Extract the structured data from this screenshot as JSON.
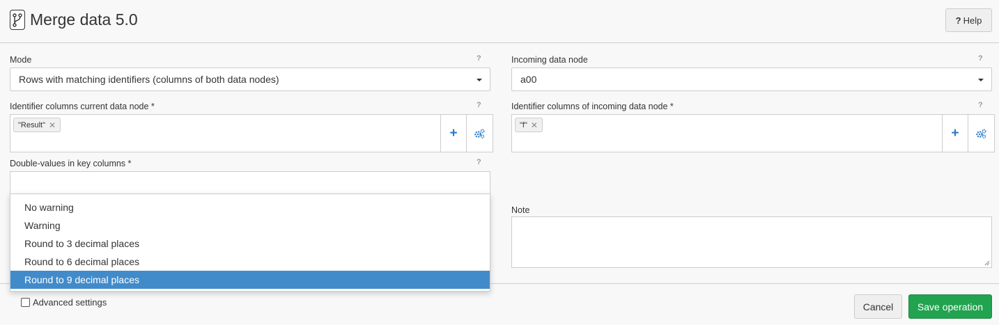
{
  "header": {
    "title": "Merge data 5.0",
    "help_label": "Help",
    "help_icon": "?"
  },
  "mode": {
    "label": "Mode",
    "value": "Rows with matching identifiers (columns of both data nodes)",
    "help": "?"
  },
  "incoming_node": {
    "label": "Incoming data node",
    "value": "a00",
    "help": "?"
  },
  "id_current": {
    "label": "Identifier columns current data node *",
    "tags": [
      "\"Result\""
    ],
    "remove": "✕",
    "help": "?"
  },
  "id_incoming": {
    "label": "Identifier columns of incoming data node *",
    "tags": [
      "\"f\""
    ],
    "remove": "✕",
    "help": "?"
  },
  "double_values": {
    "label": "Double-values in key columns *",
    "help": "?",
    "options": [
      "No warning",
      "Warning",
      "Round to 3 decimal places",
      "Round to 6 decimal places",
      "Round to 9 decimal places"
    ],
    "highlighted": "Round to 9 decimal places"
  },
  "note": {
    "label": "Note"
  },
  "footer": {
    "advanced_label": "Advanced settings",
    "cancel_label": "Cancel",
    "save_label": "Save operation"
  },
  "colors": {
    "accent": "#428bca",
    "save": "#22a34f",
    "icon_blue": "#2a78c3"
  }
}
